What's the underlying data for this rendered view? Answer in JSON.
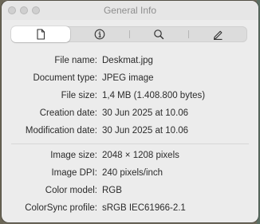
{
  "window": {
    "title": "General Info"
  },
  "toolbar": {
    "tabs": [
      {
        "icon": "document-icon",
        "selected": true
      },
      {
        "icon": "info-icon",
        "selected": false
      },
      {
        "icon": "search-icon",
        "selected": false
      },
      {
        "icon": "pencil-icon",
        "selected": false
      }
    ]
  },
  "file_info": [
    {
      "label": "File name:",
      "value": "Deskmat.jpg"
    },
    {
      "label": "Document type:",
      "value": "JPEG image"
    },
    {
      "label": "File size:",
      "value": "1,4 MB (1.408.800 bytes)"
    },
    {
      "label": "Creation date:",
      "value": "30 Jun 2025 at 10.06"
    },
    {
      "label": "Modification date:",
      "value": "30 Jun 2025 at 10.06"
    }
  ],
  "image_info": [
    {
      "label": "Image size:",
      "value": "2048 × 1208 pixels"
    },
    {
      "label": "Image DPI:",
      "value": "240 pixels/inch"
    },
    {
      "label": "Color model:",
      "value": "RGB"
    },
    {
      "label": "ColorSync profile:",
      "value": "sRGB IEC61966-2.1"
    }
  ]
}
